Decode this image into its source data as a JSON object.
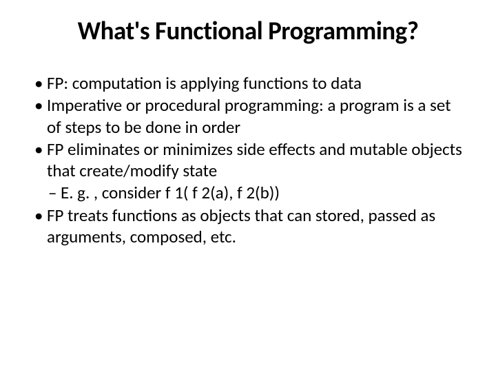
{
  "slide": {
    "title": "What's Functional Programming?",
    "bullets": [
      {
        "text": "FP: computation is applying functions to data"
      },
      {
        "text": "Imperative or procedural programming: a program is a set of steps to be done in order"
      },
      {
        "text": "FP eliminates or minimizes side effects and mutable objects that create/modify state",
        "sub": [
          {
            "text": "E. g. , consider f 1( f 2(a), f 2(b))"
          }
        ]
      },
      {
        "text": "FP treats functions as objects that can stored, passed as arguments, composed, etc."
      }
    ]
  }
}
